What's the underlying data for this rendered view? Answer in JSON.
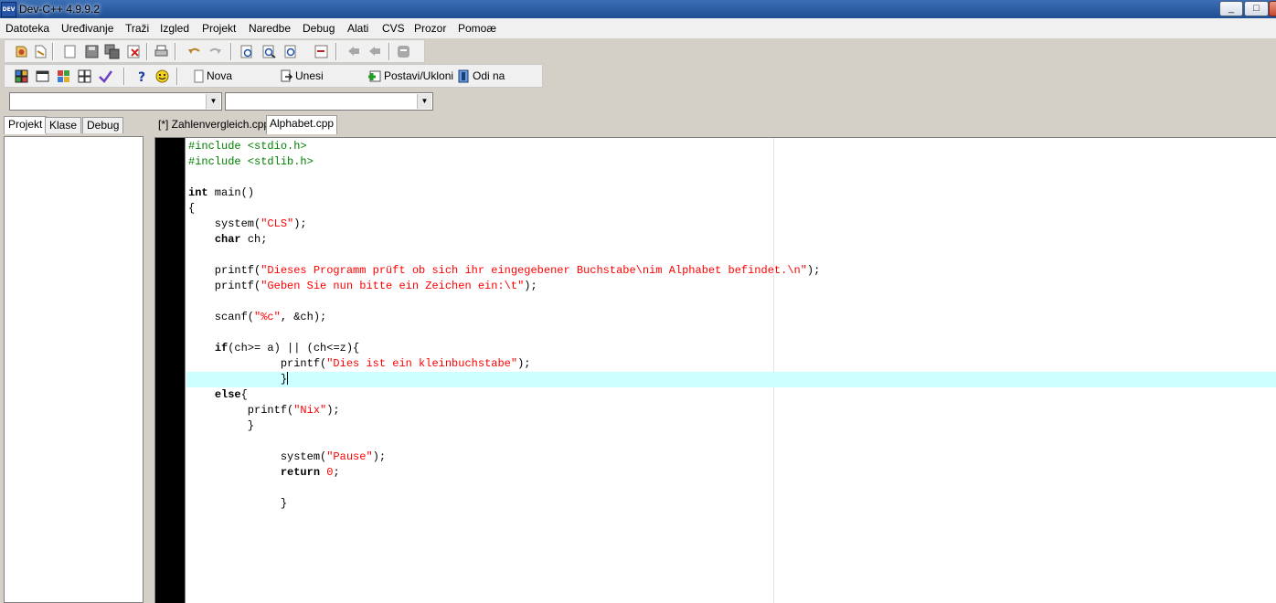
{
  "window": {
    "title": "Dev-C++ 4.9.9.2",
    "app_icon_text": "DEV",
    "buttons": {
      "minimize": "_",
      "maximize": "□",
      "close": "✕"
    }
  },
  "menu": [
    "Datoteka",
    "Uređivanje",
    "Traži",
    "Izgled",
    "Projekt",
    "Naredbe",
    "Debug",
    "Alati",
    "CVS",
    "Prozor",
    "Pomoæ"
  ],
  "toolbar2": {
    "nova": "Nova",
    "unesi": "Unesi",
    "postavi": "Postavi/Ukloni",
    "odi_na": "Odi na"
  },
  "combos": {
    "class_combo": "",
    "member_combo": ""
  },
  "left_tabs": [
    "Projekt",
    "Klase",
    "Debug"
  ],
  "editor_tabs": [
    "[*] Zahlenvergleich.cpp",
    "Alphabet.cpp"
  ],
  "active_editor_tab": "Alphabet.cpp",
  "code_lines": [
    "#include <stdio.h>",
    "#include <stdlib.h>",
    "",
    "int main()",
    "{",
    "    system(\"CLS\");",
    "    char ch;",
    "",
    "    printf(\"Dieses Programm prüft ob sich ihr eingegebener Buchstabe\\nim Alphabet befindet.\\n\");",
    "    printf(\"Geben Sie nun bitte ein Zeichen ein:\\t\");",
    "",
    "    scanf(\"%c\", &ch);",
    "",
    "    if(ch>= a) || (ch<=z){",
    "              printf(\"Dies ist ein kleinbuchstabe\");",
    "              }",
    "    else{",
    "         printf(\"Nix\");",
    "         }",
    "",
    "              system(\"Pause\");",
    "              return 0;",
    "",
    "              }"
  ],
  "colors": {
    "preprocessor": "#008000",
    "string": "#ff0000",
    "current_line": "#ccffff",
    "gutter": "#000000"
  }
}
